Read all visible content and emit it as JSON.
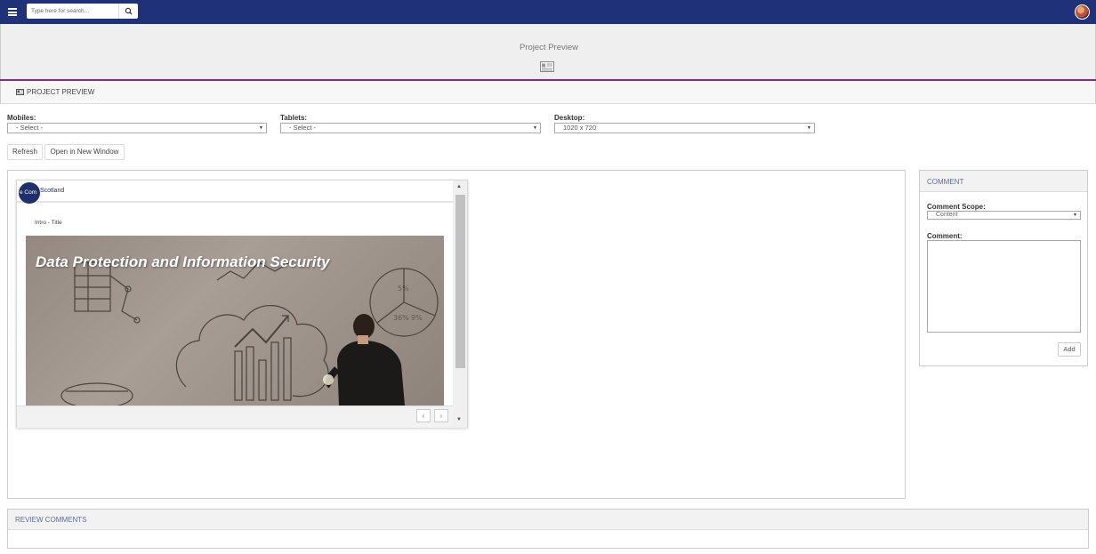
{
  "search": {
    "placeholder": "Type here for search..."
  },
  "page": {
    "title": "Project Preview"
  },
  "panel": {
    "title": "PROJECT PREVIEW"
  },
  "selectors": {
    "mobiles": {
      "label": "Mobiles:",
      "value": "- Select -"
    },
    "tablets": {
      "label": "Tablets:",
      "value": "- Select -"
    },
    "desktop": {
      "label": "Desktop:",
      "value": "1020 x 720"
    }
  },
  "buttons": {
    "refresh": "Refresh",
    "open_new_window": "Open in New Window"
  },
  "preview": {
    "logo_text": "e Com",
    "brand": "Scotland",
    "intro": "Intro - Title",
    "hero_title": "Data Protection and Information Security",
    "prev": "‹",
    "next": "›"
  },
  "comment": {
    "title": "COMMENT",
    "scope_label": "Comment Scope:",
    "scope_value": "Content",
    "comment_label": "Comment:",
    "add": "Add"
  },
  "review": {
    "title": "REVIEW COMMENTS"
  },
  "colors": {
    "nav": "#1f3178",
    "accent_line": "#8c2b7a",
    "panel_title": "#5a6d9c"
  }
}
